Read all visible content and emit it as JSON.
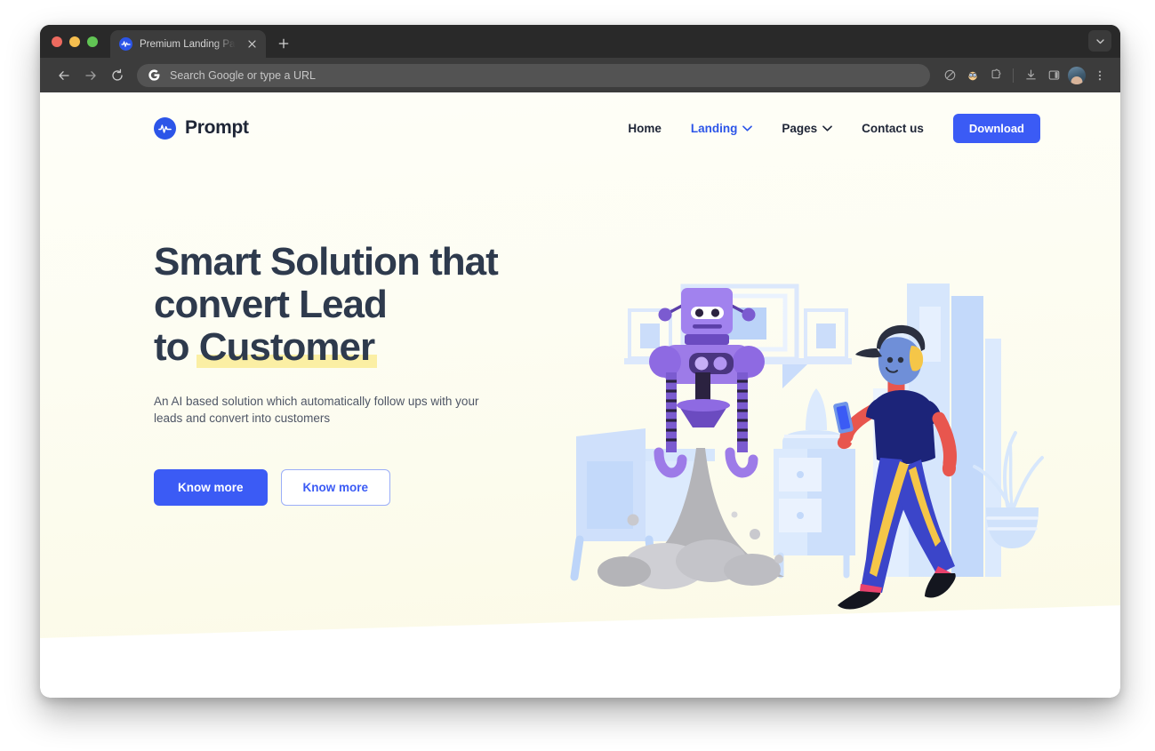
{
  "browser": {
    "tab": {
      "title": "Premium Landing Pages | Pro",
      "favicon_icon": "prompt-logo-icon",
      "close_icon": "close-icon"
    },
    "new_tab_icon": "plus-icon",
    "tabstrip_dropdown_icon": "chevron-down-icon",
    "traffic_lights": {
      "close_color": "#ED6A5F",
      "minimize_color": "#F5BE4F",
      "maximize_color": "#61C554"
    },
    "toolbar": {
      "back_icon": "arrow-left-icon",
      "forward_icon": "arrow-right-icon",
      "reload_icon": "reload-icon",
      "omnibox_placeholder": "Search Google or type a URL",
      "omnibox_value": "",
      "search_engine_icon": "google-g-icon",
      "actions": [
        {
          "icon": "tracking-protection-icon"
        },
        {
          "icon": "extension-puzzle-icon"
        },
        {
          "icon": "download-icon"
        },
        {
          "icon": "side-panel-icon"
        },
        {
          "icon": "profile-avatar-icon"
        },
        {
          "icon": "kebab-menu-icon"
        }
      ]
    }
  },
  "site": {
    "brand": {
      "name": "Prompt",
      "logo_icon": "waveform-logo-icon",
      "logo_color": "#2C55E8"
    },
    "nav": [
      {
        "label": "Home",
        "active": false,
        "has_dropdown": false
      },
      {
        "label": "Landing",
        "active": true,
        "has_dropdown": true
      },
      {
        "label": "Pages",
        "active": false,
        "has_dropdown": true
      },
      {
        "label": "Contact us",
        "active": false,
        "has_dropdown": false
      }
    ],
    "cta": {
      "label": "Download"
    },
    "hero": {
      "title_line1": "Smart Solution that",
      "title_line2": "convert Lead",
      "title_line3_prefix": "to ",
      "title_line3_highlight": "Customer",
      "highlight_color": "#FBEFA4",
      "subtitle": "An AI based solution which automatically follow ups with your leads and convert into customers",
      "primary_button": "Know more",
      "secondary_button": "Know more",
      "illustration_alt": "robot-and-person-illustration"
    }
  },
  "colors": {
    "accent_blue": "#3B5BF5",
    "brand_blue": "#2C55E8",
    "heading_navy": "#2E3A4D",
    "body_gray": "#4F5666",
    "hero_background": "#FCFBEB",
    "highlight_yellow": "#FBEFA4",
    "robot_purple": "#9D7BE8",
    "illustration_light_blue": "#CFE0FB"
  }
}
